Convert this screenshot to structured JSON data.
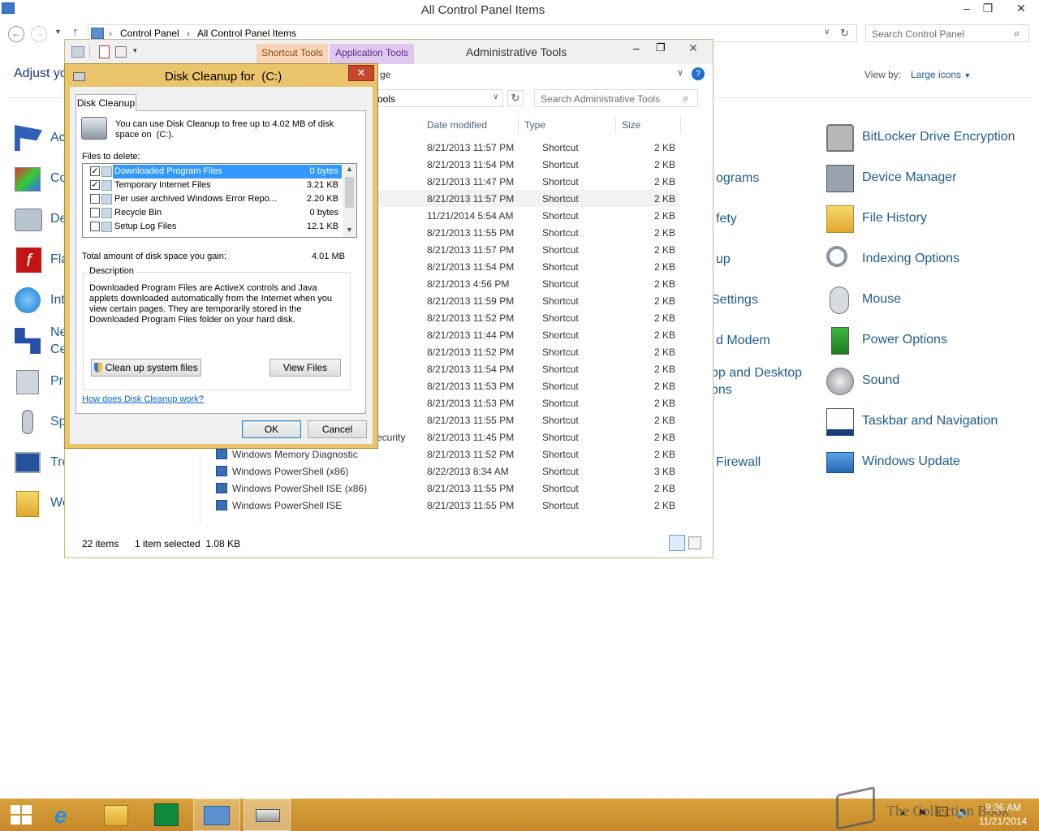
{
  "window": {
    "title": "All Control Panel Items"
  },
  "address": {
    "crumbs": [
      "Control Panel",
      "All Control Panel Items"
    ],
    "search_placeholder": "Search Control Panel"
  },
  "control_panel": {
    "adjust_label": "Adjust yo",
    "view_by_label": "View by:",
    "view_by_value": "Large icons",
    "left_items": [
      "Ac",
      "Co",
      "De",
      "Fla",
      "Int",
      "Ne",
      "Ce",
      "Pr",
      "Sp",
      "Tro",
      "Wo"
    ],
    "mid_items": [
      "ograms",
      "fety",
      "up",
      "Settings",
      "d Modem",
      "op and Desktop",
      "ons",
      "Firewall"
    ],
    "right_items": [
      "BitLocker Drive Encryption",
      "Device Manager",
      "File History",
      "Indexing Options",
      "Mouse",
      "Power Options",
      "Sound",
      "Taskbar and Navigation",
      "Windows Update"
    ]
  },
  "admin": {
    "title": "Administrative Tools",
    "tab_shortcut": "Shortcut Tools",
    "tab_application": "Application Tools",
    "ribbon_partial": "ge",
    "path_partial": "ools",
    "search_placeholder": "Search Administrative Tools",
    "columns": {
      "date": "Date modified",
      "type": "Type",
      "size": "Size"
    },
    "rows": [
      {
        "name": "",
        "date": "8/21/2013 11:57 PM",
        "type": "Shortcut",
        "size": "2 KB"
      },
      {
        "name": "",
        "date": "8/21/2013 11:54 PM",
        "type": "Shortcut",
        "size": "2 KB"
      },
      {
        "name": "",
        "date": "8/21/2013 11:47 PM",
        "type": "Shortcut",
        "size": "2 KB"
      },
      {
        "name": "",
        "date": "8/21/2013 11:57 PM",
        "type": "Shortcut",
        "size": "2 KB"
      },
      {
        "name": "",
        "date": "11/21/2014 5:54 AM",
        "type": "Shortcut",
        "size": "2 KB"
      },
      {
        "name": "",
        "date": "8/21/2013 11:55 PM",
        "type": "Shortcut",
        "size": "2 KB"
      },
      {
        "name": "",
        "date": "8/21/2013 11:57 PM",
        "type": "Shortcut",
        "size": "2 KB"
      },
      {
        "name": "",
        "date": "8/21/2013 11:54 PM",
        "type": "Shortcut",
        "size": "2 KB"
      },
      {
        "name": "",
        "date": "8/21/2013 4:56 PM",
        "type": "Shortcut",
        "size": "2 KB"
      },
      {
        "name": "",
        "date": "8/21/2013 11:59 PM",
        "type": "Shortcut",
        "size": "2 KB"
      },
      {
        "name": "",
        "date": "8/21/2013 11:52 PM",
        "type": "Shortcut",
        "size": "2 KB"
      },
      {
        "name": "",
        "date": "8/21/2013 11:44 PM",
        "type": "Shortcut",
        "size": "2 KB"
      },
      {
        "name": "",
        "date": "8/21/2013 11:52 PM",
        "type": "Shortcut",
        "size": "2 KB"
      },
      {
        "name": "",
        "date": "8/21/2013 11:54 PM",
        "type": "Shortcut",
        "size": "2 KB"
      },
      {
        "name": "",
        "date": "8/21/2013 11:53 PM",
        "type": "Shortcut",
        "size": "2 KB"
      },
      {
        "name": "",
        "date": "8/21/2013 11:53 PM",
        "type": "Shortcut",
        "size": "2 KB"
      },
      {
        "name": "",
        "date": "8/21/2013 11:55 PM",
        "type": "Shortcut",
        "size": "2 KB"
      },
      {
        "name": "ecurity",
        "date": "8/21/2013 11:45 PM",
        "type": "Shortcut",
        "size": "2 KB"
      },
      {
        "name": "Windows Memory Diagnostic",
        "date": "8/21/2013 11:52 PM",
        "type": "Shortcut",
        "size": "2 KB"
      },
      {
        "name": "Windows PowerShell (x86)",
        "date": "8/22/2013 8:34 AM",
        "type": "Shortcut",
        "size": "3 KB"
      },
      {
        "name": "Windows PowerShell ISE (x86)",
        "date": "8/21/2013 11:55 PM",
        "type": "Shortcut",
        "size": "2 KB"
      },
      {
        "name": "Windows PowerShell ISE",
        "date": "8/21/2013 11:55 PM",
        "type": "Shortcut",
        "size": "2 KB"
      }
    ],
    "status_count": "22 items",
    "status_selected": "1 item selected  1.08 KB"
  },
  "dialog": {
    "title": "Disk Cleanup for  (C:)",
    "tab": "Disk Cleanup",
    "intro": "You can use Disk Cleanup to free up to 4.02 MB of disk space on  (C:).",
    "files_label": "Files to delete:",
    "files": [
      {
        "name": "Downloaded Program Files",
        "size": "0 bytes",
        "checked": true
      },
      {
        "name": "Temporary Internet Files",
        "size": "3.21 KB",
        "checked": true
      },
      {
        "name": "Per user archived Windows Error Repo...",
        "size": "2.20 KB",
        "checked": false
      },
      {
        "name": "Recycle Bin",
        "size": "0 bytes",
        "checked": false
      },
      {
        "name": "Setup Log Files",
        "size": "12.1 KB",
        "checked": false
      }
    ],
    "total_label": "Total amount of disk space you gain:",
    "total_value": "4.01 MB",
    "description_label": "Description",
    "description": "Downloaded Program Files are ActiveX controls and Java applets downloaded automatically from the Internet when you view certain pages. They are temporarily stored in the Downloaded Program Files folder on your hard disk.",
    "cleanup_system": "Clean up system files",
    "view_files": "View Files",
    "help_link": "How does Disk Cleanup work?",
    "ok": "OK",
    "cancel": "Cancel"
  },
  "taskbar": {
    "watermark": "The Collection Book",
    "time": "9:36 AM",
    "date": "11/21/2014"
  }
}
